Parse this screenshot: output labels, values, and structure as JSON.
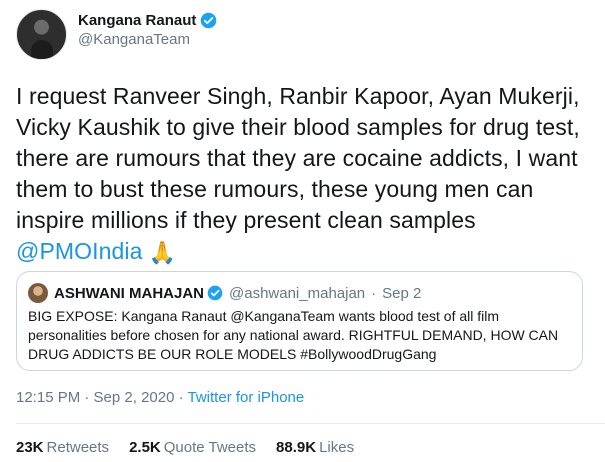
{
  "author": {
    "name": "Kangana Ranaut",
    "handle": "@KanganaTeam"
  },
  "tweet": {
    "text": "I request Ranveer Singh, Ranbir Kapoor, Ayan Mukerji, Vicky Kaushik to give their blood samples for drug test, there are rumours that they are cocaine addicts, I want them to bust these rumours, these young men can inspire millions if they present clean samples",
    "mention": "@PMOIndia",
    "emoji": "🙏"
  },
  "quoted": {
    "name": "ASHWANI MAHAJAN",
    "handle": "@ashwani_mahajan",
    "separator": "·",
    "date": "Sep 2",
    "text": "BIG EXPOSE: Kangana Ranaut @KanganaTeam wants blood test of all film personalities before chosen for any national award. RIGHTFUL DEMAND, HOW CAN DRUG ADDICTS BE OUR ROLE MODELS #BollywoodDrugGang"
  },
  "meta": {
    "timestamp": "12:15 PM · Sep 2, 2020",
    "dot": "·",
    "source": "Twitter for iPhone"
  },
  "stats": {
    "retweets_count": "23K",
    "retweets_label": "Retweets",
    "quotes_count": "2.5K",
    "quotes_label": "Quote Tweets",
    "likes_count": "88.9K",
    "likes_label": "Likes"
  },
  "colors": {
    "accent": "#1b95e0",
    "verified": "#1da1f2",
    "secondary_text": "#657786"
  }
}
